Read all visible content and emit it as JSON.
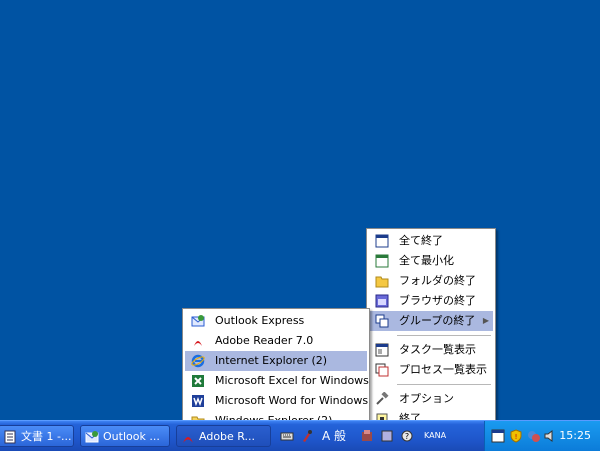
{
  "taskbar": {
    "buttons": [
      {
        "label": "文書 1 -..."
      },
      {
        "label": "Outlook ..."
      },
      {
        "label": "Adobe R..."
      }
    ],
    "ime": {
      "mode": "A 般",
      "kana": "KANA"
    },
    "clock": "15:25"
  },
  "main_menu": {
    "items": [
      {
        "label": "全て終了"
      },
      {
        "label": "全て最小化"
      },
      {
        "label": "フォルダの終了"
      },
      {
        "label": "ブラウザの終了"
      },
      {
        "label": "グループの終了"
      },
      {
        "label": "タスク一覧表示"
      },
      {
        "label": "プロセス一覧表示"
      },
      {
        "label": "オプション"
      },
      {
        "label": "終了"
      }
    ],
    "submenu_arrow": "▶"
  },
  "sub_menu": {
    "items": [
      {
        "label": "Outlook Express"
      },
      {
        "label": "Adobe Reader 7.0"
      },
      {
        "label": "Internet Explorer (2)"
      },
      {
        "label": "Microsoft Excel for Windows"
      },
      {
        "label": "Microsoft Word for Windows"
      },
      {
        "label": "Windows Explorer (2)"
      }
    ]
  },
  "colors": {
    "desktop": "#0053a3",
    "menu_highlight": "#aab8e0"
  }
}
